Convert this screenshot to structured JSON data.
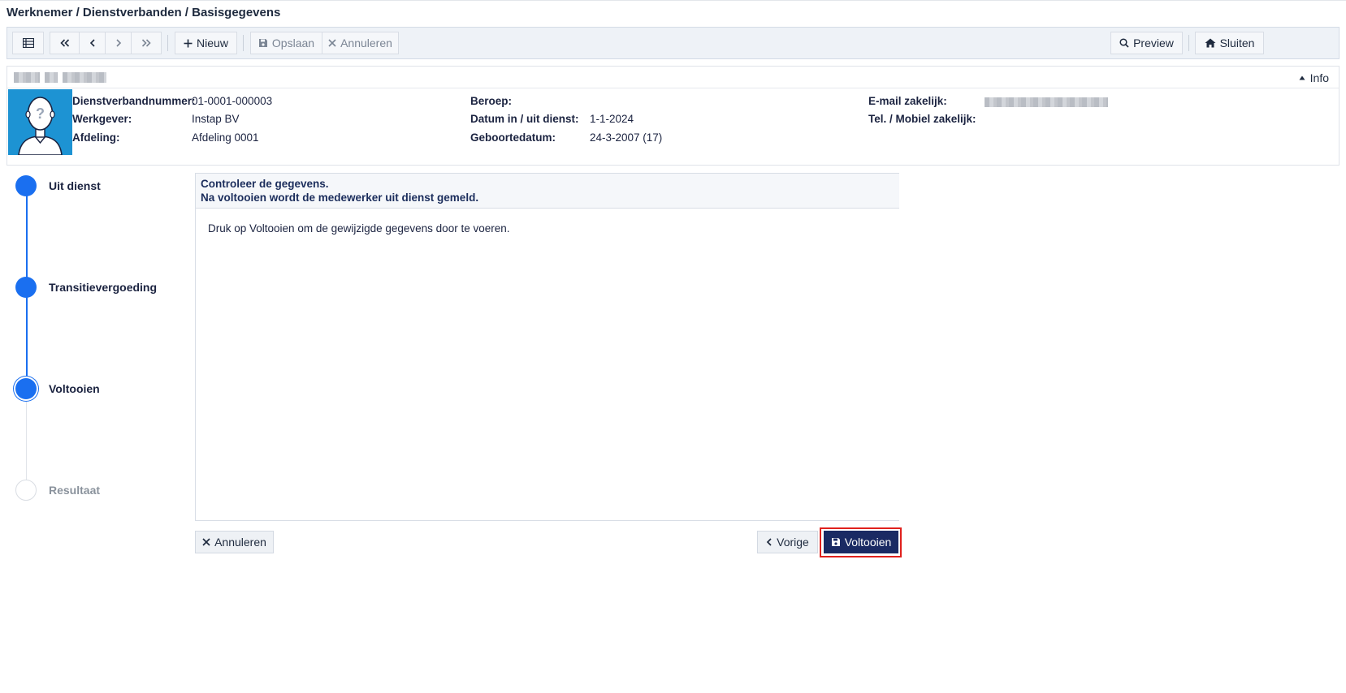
{
  "breadcrumb": "Werknemer / Dienstverbanden / Basisgegevens",
  "toolbar": {
    "new_label": "Nieuw",
    "save_label": "Opslaan",
    "cancel_label": "Annuleren",
    "preview_label": "Preview",
    "close_label": "Sluiten"
  },
  "info": {
    "toggle_label": "Info",
    "fields": {
      "dienstverband_label": "Dienstverbandnummer:",
      "dienstverband_value": "01-0001-000003",
      "werkgever_label": "Werkgever:",
      "werkgever_value": "Instap BV",
      "afdeling_label": "Afdeling:",
      "afdeling_value": "Afdeling 0001",
      "beroep_label": "Beroep:",
      "datum_label": "Datum in / uit dienst:",
      "datum_value": "1-1-2024",
      "geboorte_label": "Geboortedatum:",
      "geboorte_value": "24-3-2007 (17)",
      "email_label": "E-mail zakelijk:",
      "tel_label": "Tel. / Mobiel zakelijk:"
    }
  },
  "steps": [
    {
      "label": "Uit dienst",
      "state": "done"
    },
    {
      "label": "Transitievergoeding",
      "state": "done"
    },
    {
      "label": "Voltooien",
      "state": "current"
    },
    {
      "label": "Resultaat",
      "state": "todo"
    }
  ],
  "panel": {
    "header_line1": "Controleer de gegevens.",
    "header_line2": "Na voltooien wordt de medewerker uit dienst gemeld.",
    "body_text": "Druk op Voltooien om de gewijzigde gegevens door te voeren."
  },
  "actions": {
    "cancel_label": "Annuleren",
    "prev_label": "Vorige",
    "finish_label": "Voltooien"
  },
  "colors": {
    "accent": "#1a6ff0",
    "primary_button": "#1a2a63",
    "highlight": "#e0211d",
    "avatar_bg": "#1d93d3"
  }
}
